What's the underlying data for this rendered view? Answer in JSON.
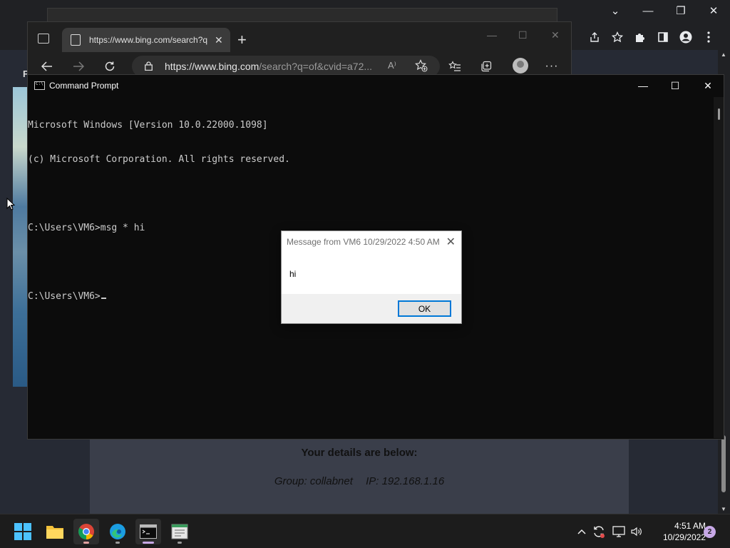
{
  "chrome": {
    "window_controls": {
      "dropdown": "⌄",
      "minimize": "—",
      "restore": "❐",
      "close": "✕"
    }
  },
  "edge": {
    "tab_title": "https://www.bing.com/search?q",
    "url_host": "https://www.bing.com",
    "url_rest": "/search?q=of&cvid=a72...",
    "read_aloud_icon": "A⁾"
  },
  "page": {
    "left_label": "F",
    "details_heading": "Your details are below:",
    "group": "Group: collabnet",
    "ip": "IP: 192.168.1.16"
  },
  "cmd": {
    "title": "Command Prompt",
    "lines": [
      "Microsoft Windows [Version 10.0.22000.1098]",
      "(c) Microsoft Corporation. All rights reserved.",
      "",
      "C:\\Users\\VM6>msg * hi",
      "",
      "C:\\Users\\VM6>"
    ]
  },
  "dialog": {
    "title": "Message from VM6 10/29/2022 4:50 AM",
    "message": "hi",
    "ok_label": "OK"
  },
  "taskbar": {
    "time": "4:51 AM",
    "date": "10/29/2022",
    "notification_count": "2",
    "apps": [
      "start",
      "file-explorer",
      "chrome",
      "edge",
      "command-prompt",
      "notepad"
    ]
  },
  "colors": {
    "taskbar": "#1c1c1c",
    "cmd_bg": "#0c0c0c",
    "cmd_text": "#cccccc",
    "dialog_button_border": "#0078d7",
    "badge": "#c7a8e6"
  }
}
